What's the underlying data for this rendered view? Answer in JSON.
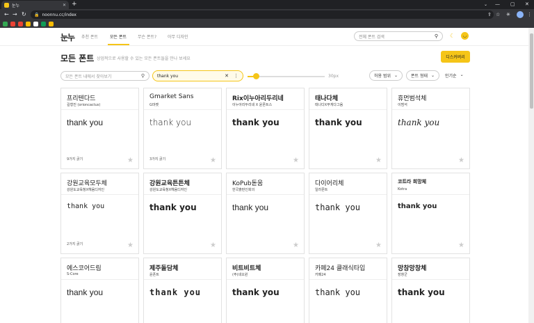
{
  "browser": {
    "tab_title": "눈누",
    "tab_close": "✕",
    "new_tab": "+",
    "tab_search_icon": "⌄",
    "window_controls": [
      "—",
      "▢",
      "✕"
    ],
    "nav": [
      "←",
      "→",
      "↻"
    ],
    "lock_icon": "🔒",
    "url": "noonnu.cc/index",
    "omnibox_icons": [
      "⇪",
      "☆",
      "✳",
      "⋮"
    ],
    "bookmark_colors": [
      "#34a853",
      "#ea4335",
      "#ea4335",
      "#fbbc04",
      "#ffffff",
      "#0f9d58",
      "#fbbc04"
    ]
  },
  "header": {
    "logo": "눈누",
    "nav": [
      {
        "label": "추천 폰트",
        "active": false
      },
      {
        "label": "모든 폰트",
        "active": true
      },
      {
        "label": "무슨 폰트?",
        "active": false
      },
      {
        "label": "아무 디자인",
        "active": false
      }
    ],
    "search_placeholder": "전체 폰트 검색",
    "search_icon": "⚲",
    "moon_icon": "☾",
    "avatar_icon": "◡"
  },
  "page": {
    "title": "모든 폰트",
    "subtitle": "상업적으로 사용할 수 있는 모든 폰트들을 만나 보세요",
    "discover_label": "디스커버리"
  },
  "filters": {
    "font_search_placeholder": "모든 폰트 내에서 찾아보기",
    "font_search_icon": "⚲",
    "preview_text": "thank you",
    "clear_icon": "✕",
    "more_icon": "⋮",
    "size_value": 20,
    "size_min": 10,
    "size_max": 100,
    "size_label": "30px",
    "license_filter": "허용 범위",
    "shape_filter": "폰트 형태",
    "sort": "인기순",
    "chevron": "⌄"
  },
  "accent_color": "#f5c518",
  "fonts": [
    {
      "name": "프리텐다드",
      "author": "길형진 (orioncactus)",
      "preview": "thank you",
      "weights": "9가지 굵기",
      "star": "★"
    },
    {
      "name": "Gmarket Sans",
      "author": "G마켓",
      "preview": "thank you",
      "weights": "3가지 굵기",
      "star": "★"
    },
    {
      "name": "Rix이누아리두리네",
      "author": "이누아리두리네 X 윤폰트스",
      "preview": "thank you",
      "weights": "",
      "star": "★"
    },
    {
      "name": "태나다체",
      "author": "태나다X무게다그움",
      "preview": "thank you",
      "weights": "",
      "star": "★"
    },
    {
      "name": "휴먼범석체",
      "author": "이범석",
      "preview": "thank you",
      "weights": "",
      "star": "★"
    },
    {
      "name": "강원교육모두체",
      "author": "강원도교육청X헤움디자인",
      "preview": "thank you",
      "weights": "2가지 굵기",
      "star": "★"
    },
    {
      "name": "강원교육튼튼체",
      "author": "강원도교육청X헤움디자인",
      "preview": "thank you",
      "weights": "",
      "star": "★"
    },
    {
      "name": "KoPub돋움",
      "author": "한국출판인회의",
      "preview": "thank you",
      "weights": "",
      "star": "★"
    },
    {
      "name": "다이어리체",
      "author": "일러폰트",
      "preview": "thank you",
      "weights": "",
      "star": "★"
    },
    {
      "name": "코트라 희망체",
      "author": "Kotra",
      "preview": "thank you",
      "weights": "",
      "star": "★"
    },
    {
      "name": "에스코어드림",
      "author": "S-Core",
      "preview": "thank you",
      "weights": "",
      "star": "★"
    },
    {
      "name": "제주돌담체",
      "author": "윤폰트",
      "preview": "thank you",
      "weights": "",
      "star": "★"
    },
    {
      "name": "비트비트체",
      "author": "(주)네오윈",
      "preview": "thank you",
      "weights": "",
      "star": "★"
    },
    {
      "name": "카페24 클래식타입",
      "author": "카페24",
      "preview": "thank you",
      "weights": "",
      "star": "★"
    },
    {
      "name": "망창망창체",
      "author": "장창군",
      "preview": "thank you",
      "weights": "",
      "star": "★"
    }
  ]
}
